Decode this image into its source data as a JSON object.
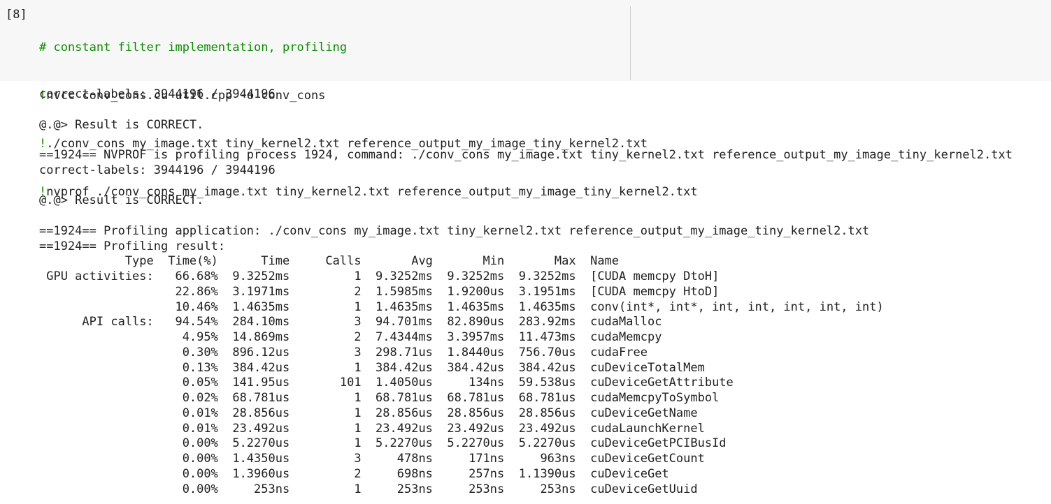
{
  "cell": {
    "execution_count": "[8]",
    "code_lines": [
      {
        "prefix": "",
        "text": "# constant filter implementation, profiling",
        "kind": "comment"
      },
      {
        "prefix": "!",
        "text": "nvcc conv_cons.cu util.cpp -o conv_cons",
        "kind": "shell"
      },
      {
        "prefix": "!",
        "text": "./conv_cons my_image.txt tiny_kernel2.txt reference_output_my_image_tiny_kernel2.txt",
        "kind": "shell"
      },
      {
        "prefix": "!",
        "text": "nvprof ./conv_cons my_image.txt tiny_kernel2.txt reference_output_my_image_tiny_kernel2.txt",
        "kind": "shell"
      }
    ]
  },
  "output": {
    "lines": [
      "correct-labels: 3944196 / 3944196",
      "",
      "@.@> Result is CORRECT.",
      "",
      "==1924== NVPROF is profiling process 1924, command: ./conv_cons my_image.txt tiny_kernel2.txt reference_output_my_image_tiny_kernel2.txt",
      "correct-labels: 3944196 / 3944196",
      "",
      "@.@> Result is CORRECT.",
      "",
      "==1924== Profiling application: ./conv_cons my_image.txt tiny_kernel2.txt reference_output_my_image_tiny_kernel2.txt",
      "==1924== Profiling result:",
      "            Type  Time(%)      Time     Calls       Avg       Min       Max  Name",
      " GPU activities:   66.68%  9.3252ms         1  9.3252ms  9.3252ms  9.3252ms  [CUDA memcpy DtoH]",
      "                   22.86%  3.1971ms         2  1.5985ms  1.9200us  3.1951ms  [CUDA memcpy HtoD]",
      "                   10.46%  1.4635ms         1  1.4635ms  1.4635ms  1.4635ms  conv(int*, int*, int, int, int, int, int)",
      "      API calls:   94.54%  284.10ms         3  94.701ms  82.890us  283.92ms  cudaMalloc",
      "                    4.95%  14.869ms         2  7.4344ms  3.3957ms  11.473ms  cudaMemcpy",
      "                    0.30%  896.12us         3  298.71us  1.8440us  756.70us  cudaFree",
      "                    0.13%  384.42us         1  384.42us  384.42us  384.42us  cuDeviceTotalMem",
      "                    0.05%  141.95us       101  1.4050us     134ns  59.538us  cuDeviceGetAttribute",
      "                    0.02%  68.781us         1  68.781us  68.781us  68.781us  cudaMemcpyToSymbol",
      "                    0.01%  28.856us         1  28.856us  28.856us  28.856us  cuDeviceGetName",
      "                    0.01%  23.492us         1  23.492us  23.492us  23.492us  cudaLaunchKernel",
      "                    0.00%  5.2270us         1  5.2270us  5.2270us  5.2270us  cuDeviceGetPCIBusId",
      "                    0.00%  1.4350us         3     478ns     171ns     963ns  cuDeviceGetCount",
      "                    0.00%  1.3960us         2     698ns     257ns  1.1390us  cuDeviceGet",
      "                    0.00%     253ns         1     253ns     253ns     253ns  cuDeviceGetUuid"
    ]
  },
  "colors": {
    "input_background": "#f7f7f7",
    "comment": "#0b8a00",
    "text": "#212121"
  }
}
